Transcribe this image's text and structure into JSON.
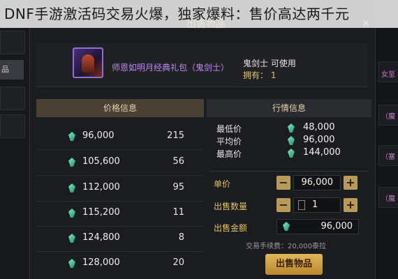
{
  "headline": "DNF手游激活码交易火爆，独家爆料：售价高达两千元",
  "dialog": {
    "title": "出售物品",
    "close": "×"
  },
  "left_strip": {
    "label": "品"
  },
  "right_strip": {
    "items": [
      "女至",
      "（魔",
      "（塞",
      "（魔"
    ]
  },
  "item": {
    "name": "师恩如明月经典礼包（鬼剑士）",
    "class_line": "鬼剑士 可使用",
    "owned": "拥有： 1"
  },
  "price_panel": {
    "header": "价格信息",
    "rows": [
      {
        "price": "96,000",
        "qty": "215"
      },
      {
        "price": "105,600",
        "qty": "56"
      },
      {
        "price": "112,000",
        "qty": "95"
      },
      {
        "price": "115,200",
        "qty": "11"
      },
      {
        "price": "124,800",
        "qty": "8"
      },
      {
        "price": "128,000",
        "qty": "20"
      }
    ]
  },
  "market_panel": {
    "header": "行情信息",
    "min_label": "最低价",
    "min": "48,000",
    "avg_label": "平均价",
    "avg": "96,000",
    "max_label": "最高价",
    "max": "144,000"
  },
  "form": {
    "unit_label": "单价",
    "unit_value": "96,000",
    "qty_label": "出售数量",
    "qty_value": "1",
    "total_label": "出售金额",
    "total_value": "96,000",
    "minus": "−",
    "plus": "+"
  },
  "fee_text": "交易手续费：20,000泰拉",
  "sell_button": "出售物品",
  "colors": {
    "accent_gold": "#e0c266",
    "item_purple": "#b98cf0",
    "gem_green": "#4fd6a0"
  }
}
